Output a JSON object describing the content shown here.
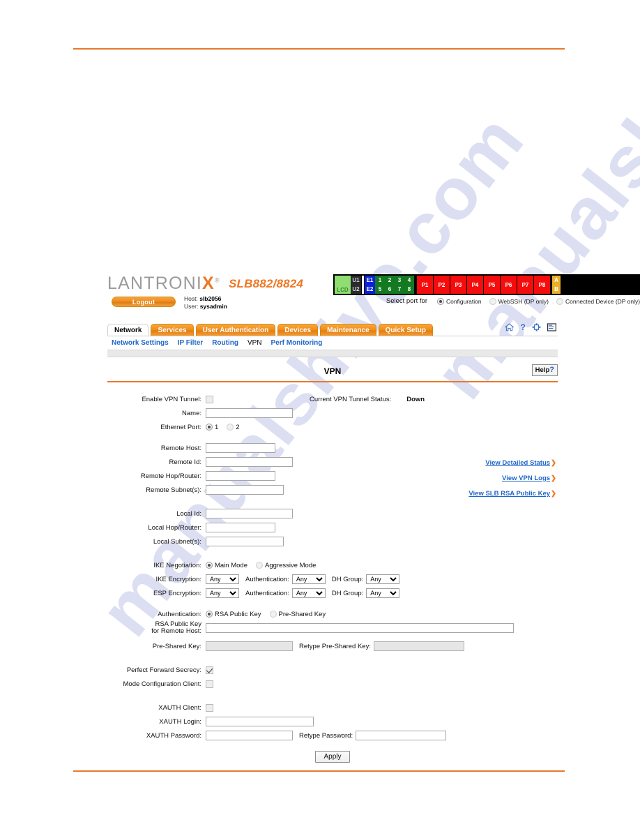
{
  "branding": {
    "logo_text": "LANTRONIX",
    "logo_registered": "®",
    "model": "SLB882/8824"
  },
  "session": {
    "logout_label": "Logout",
    "host_label": "Host:",
    "host_value": "slb2056",
    "user_label": "User:",
    "user_value": "sysadmin"
  },
  "port_panel": {
    "lcd": "LCD",
    "uplinks": [
      "U1",
      "U2"
    ],
    "ethernet": [
      "E1",
      "E2"
    ],
    "numbered": [
      "1",
      "2",
      "3",
      "4",
      "5",
      "6",
      "7",
      "8"
    ],
    "power_ports": [
      "P1",
      "P2",
      "P3",
      "P4",
      "P5",
      "P6",
      "P7",
      "P8"
    ],
    "ab": [
      "A",
      "B"
    ],
    "select_label": "Select port for",
    "options": [
      {
        "label": "Configuration",
        "selected": true
      },
      {
        "label": "WebSSH (DP only)",
        "selected": false
      },
      {
        "label": "Connected Device (DP only)",
        "selected": false
      }
    ],
    "colors": {
      "lcd": "#8ede72",
      "uplink": "#2b2b2b",
      "ethernet": "#0a23d8",
      "numbered": "#147a21",
      "power": "#f50c0c",
      "ab": "#eab029"
    }
  },
  "tabs": [
    {
      "label": "Network",
      "active": true
    },
    {
      "label": "Services",
      "active": false
    },
    {
      "label": "User Authentication",
      "active": false
    },
    {
      "label": "Devices",
      "active": false
    },
    {
      "label": "Maintenance",
      "active": false
    },
    {
      "label": "Quick Setup",
      "active": false
    }
  ],
  "header_icons": [
    {
      "name": "home-icon",
      "glyph": "home"
    },
    {
      "name": "help-icon",
      "glyph": "?"
    },
    {
      "name": "expand-icon",
      "glyph": "expand"
    },
    {
      "name": "logs-icon",
      "glyph": "list"
    }
  ],
  "subnav": [
    {
      "label": "Network Settings",
      "active": false
    },
    {
      "label": "IP Filter",
      "active": false
    },
    {
      "label": "Routing",
      "active": false
    },
    {
      "label": "VPN",
      "active": true
    },
    {
      "label": "Perf Monitoring",
      "active": false
    }
  ],
  "page": {
    "title": "VPN",
    "help_label": "Help",
    "help_mark": "?"
  },
  "form": {
    "enable_vpn_tunnel": {
      "label": "Enable VPN Tunnel:",
      "checked": false
    },
    "tunnel_status": {
      "label": "Current VPN Tunnel Status:",
      "value": "Down"
    },
    "name": {
      "label": "Name:",
      "value": ""
    },
    "ethernet_port": {
      "label": "Ethernet Port:",
      "options": [
        {
          "label": "1",
          "selected": true
        },
        {
          "label": "2",
          "selected": false
        }
      ]
    },
    "remote_host": {
      "label": "Remote Host:",
      "value": ""
    },
    "remote_id": {
      "label": "Remote Id:",
      "value": ""
    },
    "remote_hop_router": {
      "label": "Remote Hop/Router:",
      "value": ""
    },
    "remote_subnets": {
      "label": "Remote Subnet(s):",
      "value": ""
    },
    "local_id": {
      "label": "Local Id:",
      "value": ""
    },
    "local_hop_router": {
      "label": "Local Hop/Router:",
      "value": ""
    },
    "local_subnets": {
      "label": "Local Subnet(s):",
      "value": ""
    },
    "ike_negotiation": {
      "label": "IKE Negotiation:",
      "options": [
        {
          "label": "Main Mode",
          "selected": true
        },
        {
          "label": "Aggressive Mode",
          "selected": false
        }
      ]
    },
    "ike_encryption": {
      "label": "IKE Encryption:",
      "value": "Any"
    },
    "ike_authentication": {
      "label": "Authentication:",
      "value": "Any"
    },
    "ike_dh_group": {
      "label": "DH Group:",
      "value": "Any"
    },
    "esp_encryption": {
      "label": "ESP Encryption:",
      "value": "Any"
    },
    "esp_authentication": {
      "label": "Authentication:",
      "value": "Any"
    },
    "esp_dh_group": {
      "label": "DH Group:",
      "value": "Any"
    },
    "authentication": {
      "label": "Authentication:",
      "options": [
        {
          "label": "RSA Public Key",
          "selected": true
        },
        {
          "label": "Pre-Shared Key",
          "selected": false
        }
      ]
    },
    "rsa_public_key": {
      "label_line1": "RSA Public Key",
      "label_line2": "for Remote Host:",
      "value": ""
    },
    "pre_shared_key": {
      "label": "Pre-Shared Key:",
      "value": "",
      "disabled": true
    },
    "retype_pre_shared_key": {
      "label": "Retype Pre-Shared Key:",
      "value": "",
      "disabled": true
    },
    "perfect_forward_secrecy": {
      "label": "Perfect Forward Secrecy:",
      "checked": true
    },
    "mode_configuration_client": {
      "label": "Mode Configuration Client:",
      "checked": false
    },
    "xauth_client": {
      "label": "XAUTH Client:",
      "checked": false
    },
    "xauth_login": {
      "label": "XAUTH Login:",
      "value": ""
    },
    "xauth_password": {
      "label": "XAUTH Password:",
      "value": ""
    },
    "retype_password": {
      "label": "Retype Password:",
      "value": ""
    },
    "apply_label": "Apply",
    "select_options": [
      "Any"
    ]
  },
  "side_links": [
    {
      "label": "View Detailed Status"
    },
    {
      "label": "View VPN Logs"
    },
    {
      "label": "View SLB RSA Public Key"
    }
  ],
  "watermark": {
    "text": "manualshive.com"
  },
  "colors": {
    "accent_orange": "#e8792b",
    "link_blue": "#1f66c9",
    "tab_orange": "#ef8b1c"
  }
}
